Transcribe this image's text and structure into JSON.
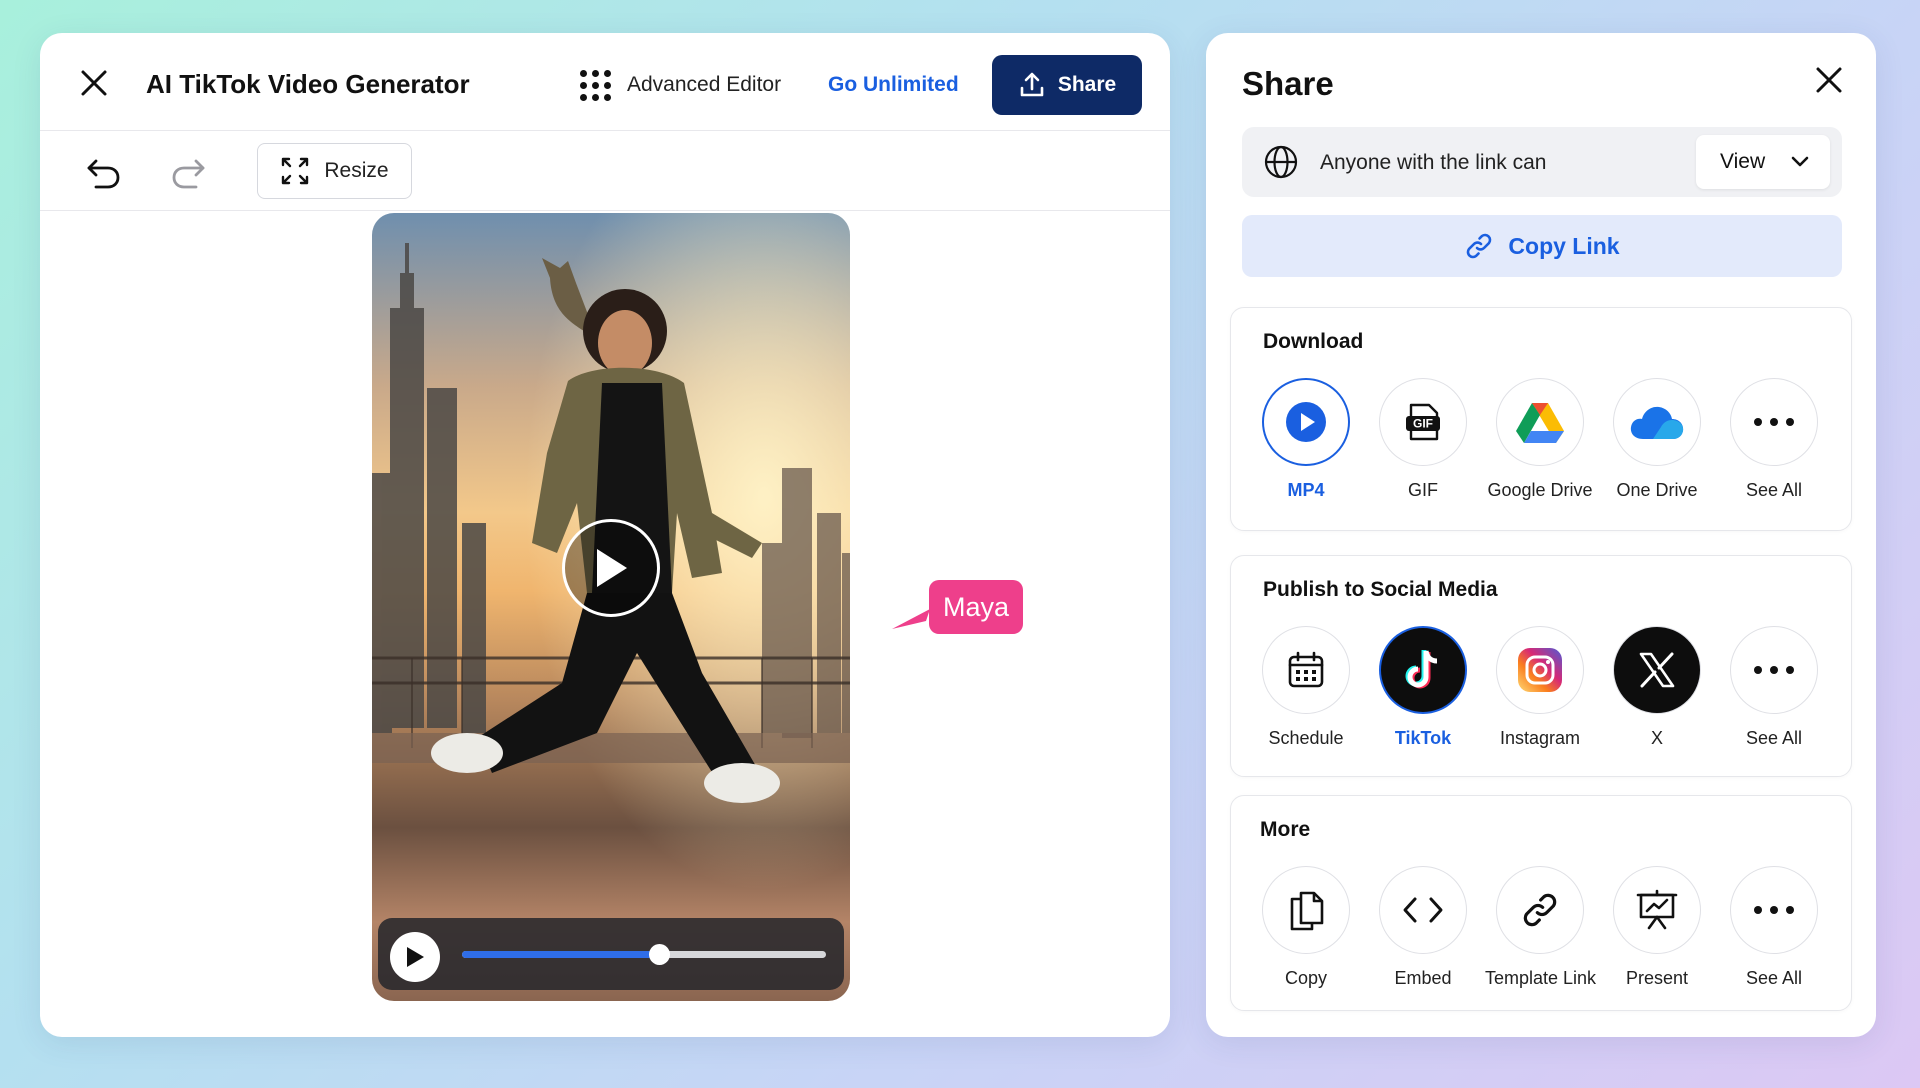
{
  "editor": {
    "title": "AI TikTok Video Generator",
    "advanced_label": "Advanced Editor",
    "unlimited_label": "Go Unlimited",
    "share_label": "Share",
    "resize_label": "Resize",
    "tag_label": "Maya",
    "playback_progress": 0.54
  },
  "share": {
    "title": "Share",
    "permission_text": "Anyone with the link can",
    "permission_value": "View",
    "copy_link_label": "Copy Link",
    "download": {
      "title": "Download",
      "options": [
        "MP4",
        "GIF",
        "Google Drive",
        "One Drive",
        "See All"
      ],
      "gif_badge": "GIF"
    },
    "social": {
      "title": "Publish to Social Media",
      "options": [
        "Schedule",
        "TikTok",
        "Instagram",
        "X",
        "See All"
      ]
    },
    "more": {
      "title": "More",
      "options": [
        "Copy",
        "Embed",
        "Template Link",
        "Present",
        "See All"
      ]
    }
  },
  "colors": {
    "accent": "#1a5fe0",
    "share_button": "#0e2a66",
    "tag": "#ee3f8b",
    "progress": "#2f6de8"
  },
  "icons": {
    "editor": [
      "close-icon",
      "grid-icon",
      "upload-icon",
      "undo-icon",
      "redo-icon",
      "resize-icon",
      "play-icon"
    ],
    "share": [
      "close-icon",
      "globe-icon",
      "chevron-down-icon",
      "link-icon",
      "play-circle-icon",
      "gif-icon",
      "google-drive-icon",
      "onedrive-icon",
      "more-icon",
      "calendar-icon",
      "tiktok-icon",
      "instagram-icon",
      "x-icon",
      "copy-icon",
      "code-icon",
      "present-icon"
    ]
  }
}
